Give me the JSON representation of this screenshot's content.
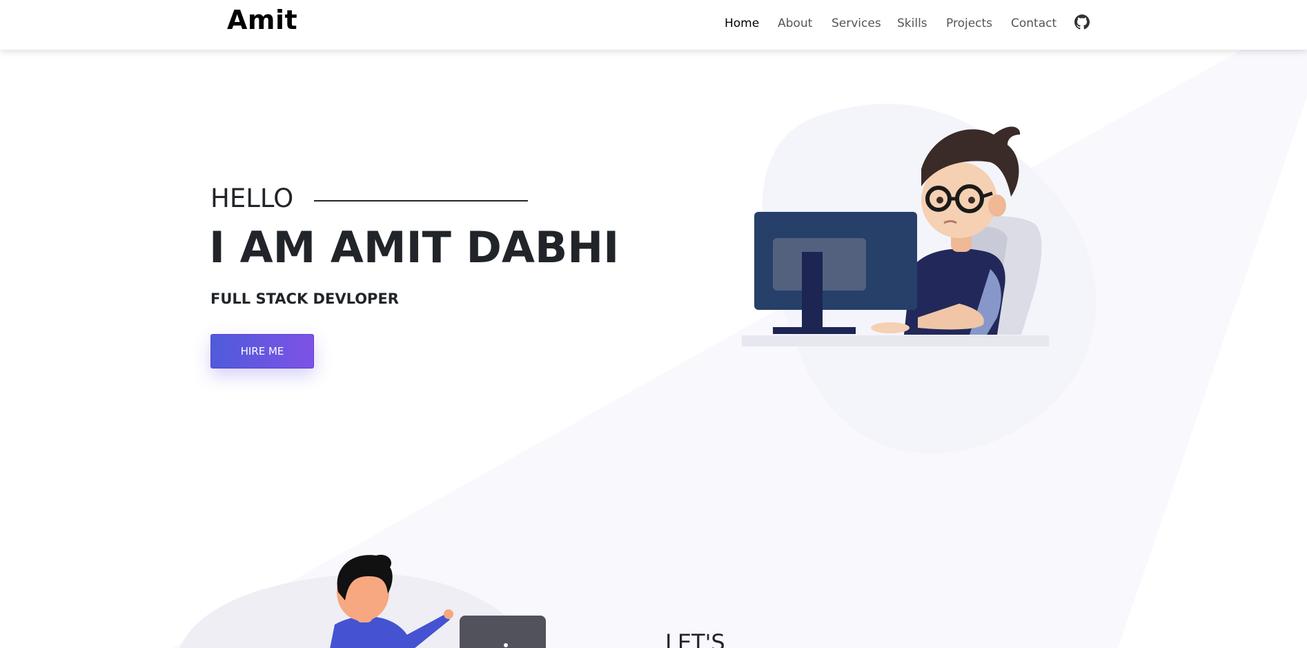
{
  "nav": {
    "brand": "Amit",
    "links": [
      {
        "label": "Home",
        "active": true
      },
      {
        "label": "About"
      },
      {
        "label": "Services"
      },
      {
        "label": "Skills"
      },
      {
        "label": "Projects"
      },
      {
        "label": "Contact"
      }
    ],
    "github_icon": "github-icon"
  },
  "hero": {
    "greeting": "HELLO",
    "name_line": "I AM AMIT DABHI",
    "role": "FULL STACK DEVLOPER",
    "cta_label": "HIRE ME"
  },
  "next_section": {
    "heading_partial": "LET'S"
  },
  "colors": {
    "accent_start": "#4f5bdb",
    "accent_end": "#7e52e6",
    "text": "#212529",
    "band": "#f8f8fd"
  }
}
